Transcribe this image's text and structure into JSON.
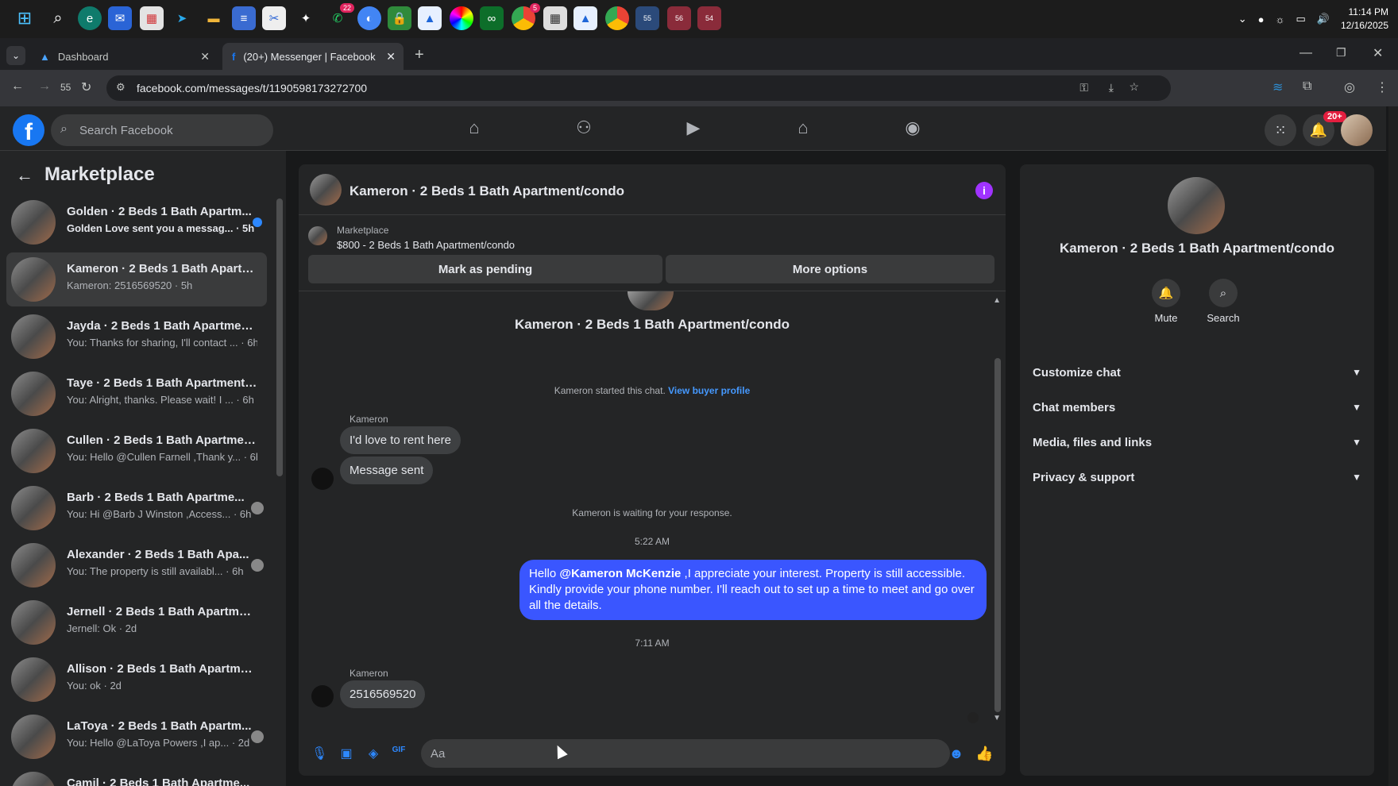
{
  "taskbar": {
    "badges": {
      "whatsapp": "22",
      "chrome": "5"
    },
    "clock_time": "11:14 PM",
    "clock_date": "12/16/2025",
    "app_tab_counts": [
      "55",
      "56",
      "54"
    ]
  },
  "browser": {
    "tabs": [
      {
        "label": "Dashboard"
      },
      {
        "label": "(20+) Messenger | Facebook"
      }
    ],
    "tab_count": "55",
    "url": "facebook.com/messages/t/1190598173272700"
  },
  "fb": {
    "search_placeholder": "Search Facebook",
    "notif_badge": "20+"
  },
  "sidebar": {
    "title": "Marketplace",
    "conversations": [
      {
        "name": "Golden · 2 Beds 1 Bath Apartm...",
        "snippet": "Golden Love sent you a messag... · 5h",
        "unread": true
      },
      {
        "name": "Kameron · 2 Beds 1 Bath Apartm...",
        "snippet": "Kameron: 2516569520 · 5h",
        "unread": false
      },
      {
        "name": "Jayda · 2 Beds 1 Bath Apartment...",
        "snippet": "You: Thanks for sharing, I'll contact ... · 6h",
        "unread": false
      },
      {
        "name": "Taye · 2 Beds 1 Bath Apartment/...",
        "snippet": "You: Alright, thanks. Please wait! I ... · 6h",
        "unread": false
      },
      {
        "name": "Cullen · 2 Beds 1 Bath Apartmen...",
        "snippet": "You: Hello @Cullen Farnell ,Thank y... · 6h",
        "unread": false
      },
      {
        "name": "Barb · 2 Beds 1 Bath Apartme...",
        "snippet": "You: Hi @Barb J Winston ,Access... · 6h",
        "unread": false
      },
      {
        "name": "Alexander · 2 Beds 1 Bath Apa...",
        "snippet": "You: The property is still availabl... · 6h",
        "unread": false
      },
      {
        "name": "Jernell · 2 Beds 1 Bath Apartmen...",
        "snippet": "Jernell: Ok · 2d",
        "unread": false
      },
      {
        "name": "Allison · 2 Beds 1 Bath Apartmen...",
        "snippet": "You: ok · 2d",
        "unread": false
      },
      {
        "name": "LaToya · 2 Beds 1 Bath Apartm...",
        "snippet": "You: Hello @LaToya Powers ,I ap... · 2d",
        "unread": false
      },
      {
        "name": "Camil · 2 Beds 1 Bath Apartme...",
        "snippet": "",
        "unread": false
      }
    ]
  },
  "chat": {
    "title": "Kameron · 2 Beds 1 Bath Apartment/condo",
    "marketplace_label": "Marketplace",
    "listing": "$800 - 2 Beds 1 Bath Apartment/condo",
    "mark_pending": "Mark as pending",
    "more_options": "More options",
    "header_name": "Kameron · 2 Beds 1 Bath Apartment/condo",
    "started_text": "Kameron started this chat.",
    "buyer_profile_link": "View buyer profile",
    "sender1": "Kameron",
    "msg1": "I'd love to rent here",
    "msg2": "Message sent",
    "waiting": "Kameron is waiting for your response.",
    "time1": "5:22 AM",
    "out_mention": "@Kameron McKenzie",
    "out_pre": "Hello ",
    "out_post": " ,I appreciate your interest. Property is still accessible. Kindly provide your phone number. I'll reach out to set up a time to meet and go over all the details.",
    "time2": "7:11 AM",
    "sender2": "Kameron",
    "msg3": "2516569520",
    "input_placeholder": "Aa"
  },
  "right_panel": {
    "name": "Kameron · 2 Beds 1 Bath Apartment/condo",
    "mute": "Mute",
    "search": "Search",
    "sections": [
      "Customize chat",
      "Chat members",
      "Media, files and links",
      "Privacy & support"
    ]
  }
}
